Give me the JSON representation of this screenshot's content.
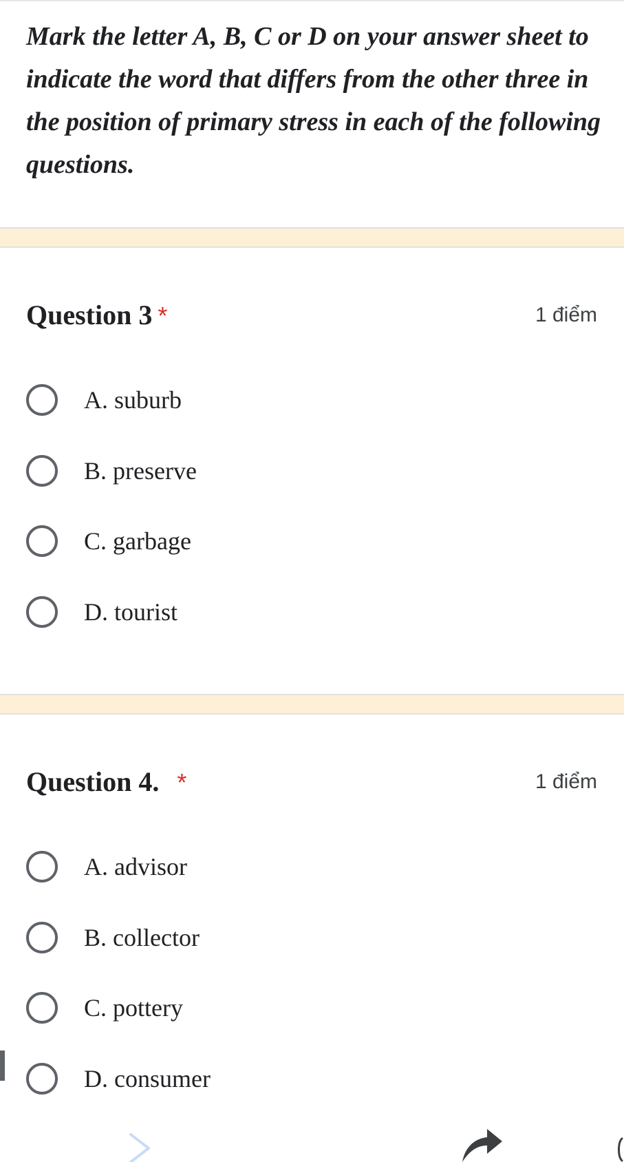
{
  "instructions": "Mark the letter A, B, C or D on your answer sheet to indicate the word that differs from the other three in the position of primary stress in each of the following questions.",
  "questions": [
    {
      "title": "Question 3",
      "required_mark": "*",
      "points": "1 điểm",
      "options": [
        {
          "label": "A. suburb"
        },
        {
          "label": "B. preserve"
        },
        {
          "label": "C. garbage"
        },
        {
          "label": "D. tourist"
        }
      ]
    },
    {
      "title": "Question 4.",
      "required_mark": "*",
      "points": "1 điểm",
      "options": [
        {
          "label": "A. advisor"
        },
        {
          "label": "B. collector"
        },
        {
          "label": "C. pottery"
        },
        {
          "label": "D. consumer"
        }
      ]
    }
  ],
  "colors": {
    "band": "#fdf0d6",
    "required": "#d93025",
    "radio_border": "#5f6368",
    "chevron": "#c8dcf5"
  },
  "icons": [
    "chevron-right-icon",
    "share-icon"
  ]
}
